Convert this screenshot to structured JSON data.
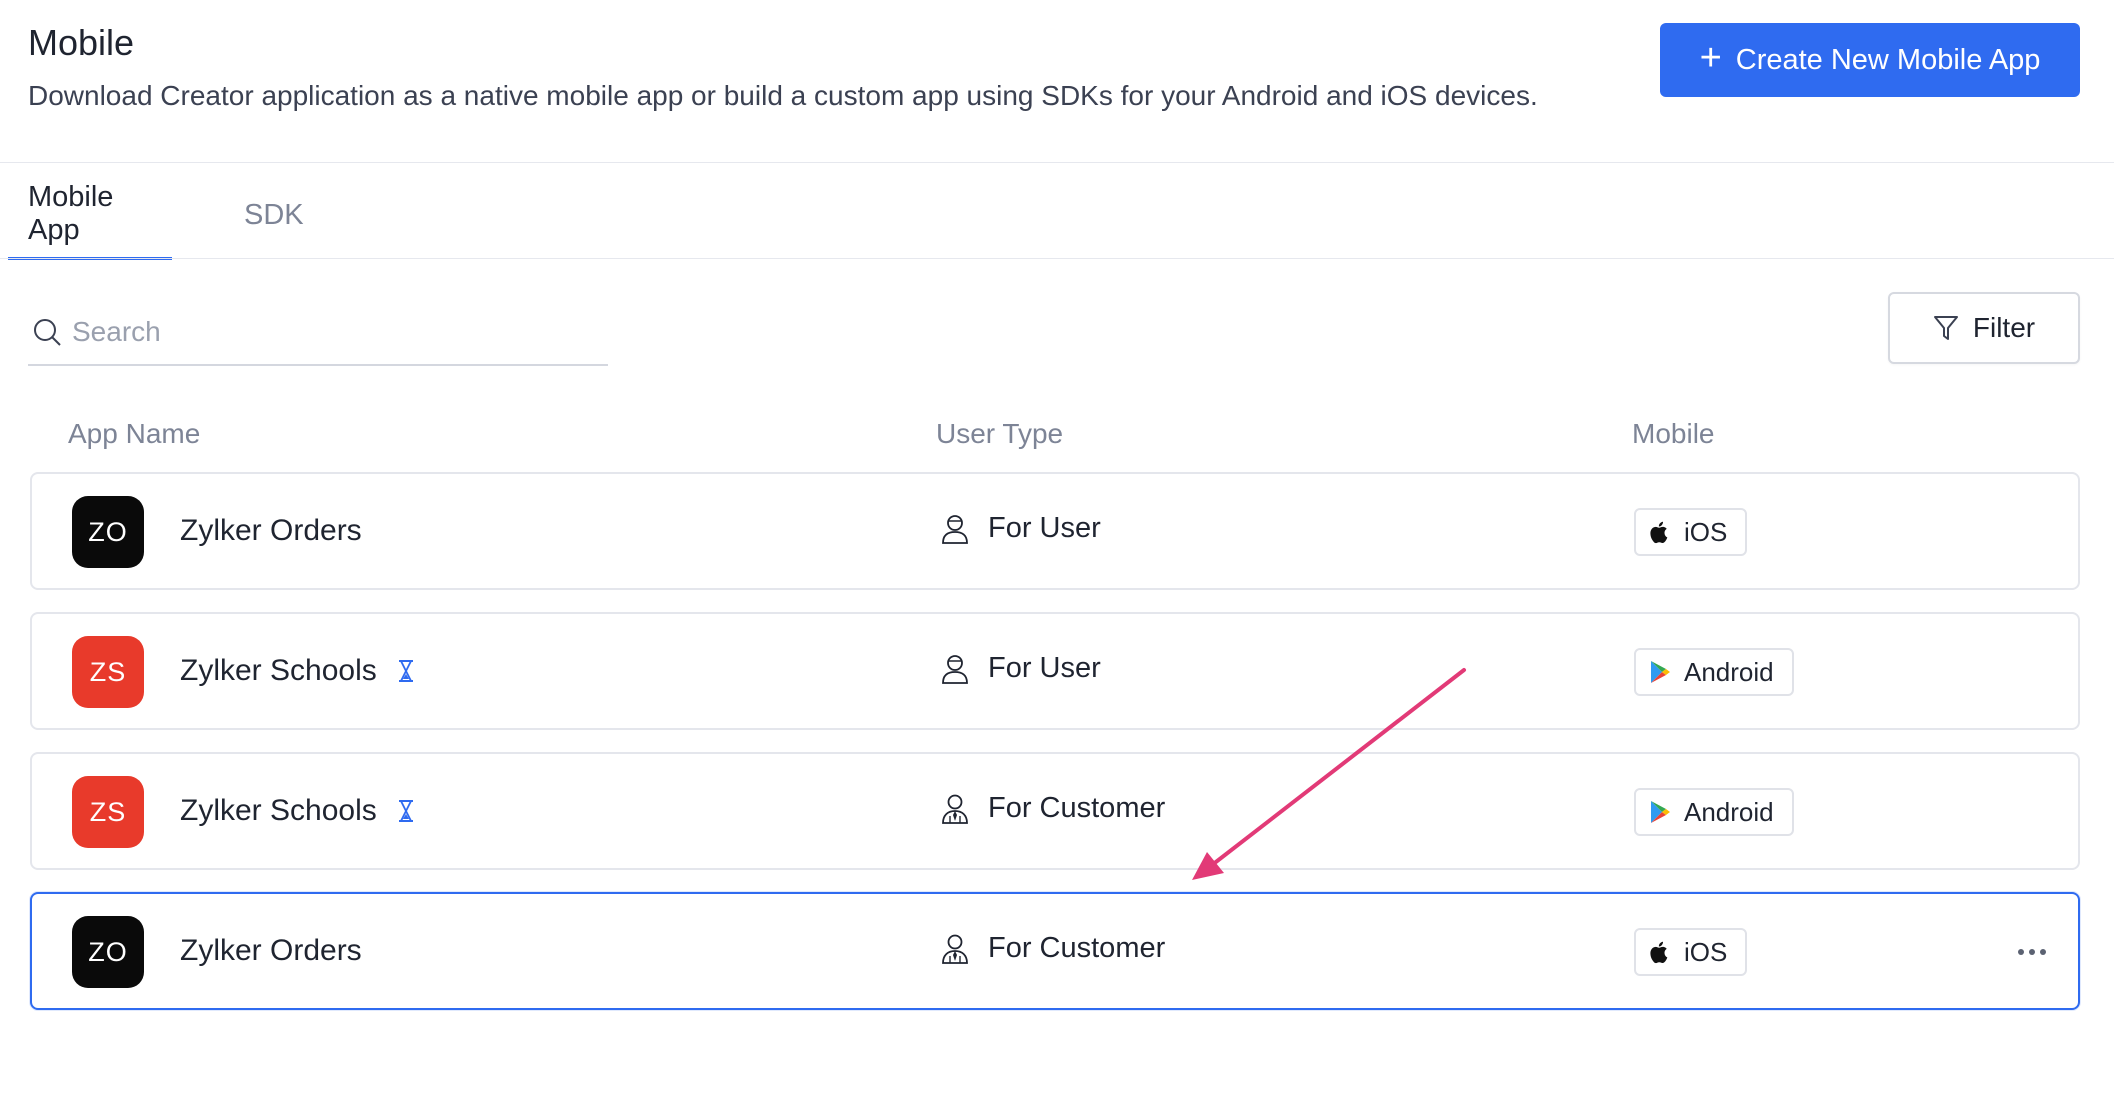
{
  "header": {
    "title": "Mobile",
    "subtitle": "Download Creator application as a native mobile app or build a custom app using SDKs for your Android and iOS devices.",
    "create_button": "Create New Mobile App"
  },
  "tabs": [
    {
      "label": "Mobile App",
      "active": true
    },
    {
      "label": "SDK",
      "active": false
    }
  ],
  "search": {
    "placeholder": "Search",
    "value": ""
  },
  "filter_label": "Filter",
  "columns": {
    "app_name": "App Name",
    "user_type": "User Type",
    "mobile": "Mobile"
  },
  "rows": [
    {
      "initials": "ZO",
      "color": "#0a0a0a",
      "name": "Zylker Orders",
      "pending": false,
      "user_type": "For User",
      "platform": "iOS",
      "selected": false
    },
    {
      "initials": "ZS",
      "color": "#e83a2b",
      "name": "Zylker Schools",
      "pending": true,
      "user_type": "For User",
      "platform": "Android",
      "selected": false
    },
    {
      "initials": "ZS",
      "color": "#e83a2b",
      "name": "Zylker Schools",
      "pending": true,
      "user_type": "For Customer",
      "platform": "Android",
      "selected": false
    },
    {
      "initials": "ZO",
      "color": "#0a0a0a",
      "name": "Zylker Orders",
      "pending": false,
      "user_type": "For Customer",
      "platform": "iOS",
      "selected": true
    }
  ],
  "colors": {
    "accent": "#2f6bf0",
    "annotation_arrow": "#e23a77"
  }
}
